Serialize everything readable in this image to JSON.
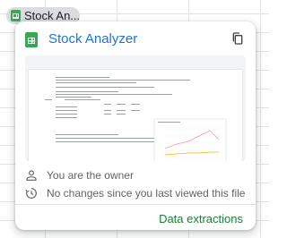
{
  "chip": {
    "label": "Stock An..."
  },
  "card": {
    "title": "Stock Analyzer",
    "owner_text": "You are the owner",
    "changes_text": "No changes since you last viewed this file",
    "action_label": "Data extractions"
  },
  "colors": {
    "title_blue": "#1a73e8",
    "sheets_green": "#34a853",
    "action_green": "#188038",
    "line_1": "#e8a0ad",
    "line_2": "#f4b400"
  },
  "icons": [
    "sheets-icon",
    "copy-icon",
    "person-icon",
    "history-icon"
  ]
}
